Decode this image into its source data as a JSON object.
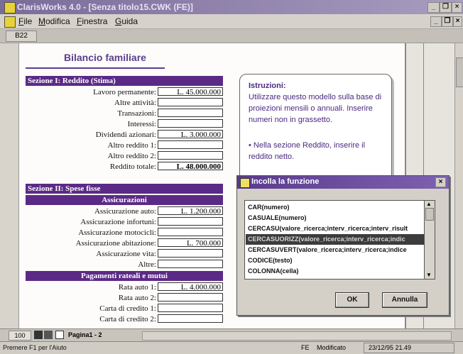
{
  "window": {
    "title": "ClarisWorks 4.0 - [Senza titolo15.CWK (FE)]"
  },
  "menu": {
    "items": [
      "File",
      "Modifica",
      "Finestra",
      "Guida"
    ]
  },
  "cell_ref": "B22",
  "sheet": {
    "title": "Bilancio familiare",
    "section1": {
      "header": "Sezione I:  Reddito (Stima)",
      "rows": [
        {
          "label": "Lavoro permanente:",
          "value": "L. 45.000.000"
        },
        {
          "label": "Altre attività:",
          "value": ""
        },
        {
          "label": "Transazioni:",
          "value": ""
        },
        {
          "label": "Interessi:",
          "value": ""
        },
        {
          "label": "Dividendi azionari:",
          "value": "L. 3.000.000"
        },
        {
          "label": "Altro reddito 1:",
          "value": ""
        },
        {
          "label": "Altro reddito 2:",
          "value": ""
        },
        {
          "label": "Reddito totale:",
          "value": "L. 48.000.000"
        }
      ]
    },
    "section2": {
      "header": "Sezione II: Spese fisse",
      "sub1": "Assicurazioni",
      "rows1": [
        {
          "label": "Assicurazione auto:",
          "value": "L. 1.200.000"
        },
        {
          "label": "Assicurazione infortuni:",
          "value": ""
        },
        {
          "label": "Assicurazione motocicli:",
          "value": ""
        },
        {
          "label": "Assicurazione abitazione:",
          "value": "L. 700.000"
        },
        {
          "label": "Assicurazione vita:",
          "value": ""
        },
        {
          "label": "Altre:",
          "value": ""
        }
      ],
      "sub2": "Pagamenti rateali e mutui",
      "rows2": [
        {
          "label": "Rata auto 1:",
          "value": "L. 4.000.000"
        },
        {
          "label": "Rata auto 2:",
          "value": ""
        },
        {
          "label": "Carta di credito 1:",
          "value": ""
        },
        {
          "label": "Carta di credito 2:",
          "value": ""
        }
      ]
    },
    "instructions": {
      "heading": "Istruzioni:",
      "body": "Utilizzare questo modello sulla base di proiezioni mensili o annuali. Inserire numeri non in grassetto.",
      "bullet": "•  Nella sezione Reddito, inserire il reddito netto."
    }
  },
  "dialog": {
    "title": "Incolla la funzione",
    "items": [
      "CAR(numero)",
      "CASUALE(numero)",
      "CERCASU(valore_ricerca;interv_ricerca;interv_risult",
      "CERCASUORIZZ(valore_ricerca;interv_ricerca;indic",
      "CERCASUVERT(valore_ricerca;interv_ricerca;indice",
      "CODICE(testo)",
      "COLONNA(cella)"
    ],
    "selected_index": 3,
    "ok_label": "OK",
    "cancel_label": "Annulla"
  },
  "bottom": {
    "zoom": "100",
    "page_label": "Pagina1 - 2"
  },
  "status": {
    "hint": "Premere F1 per l'Aiuto",
    "fe": "FE",
    "modified": "Modificato",
    "datetime": "23/12/95 21.49"
  },
  "colors": {
    "section_header": "#5b2a86",
    "title": "#5b3e90",
    "dialog_title": "#5a3a8e"
  }
}
